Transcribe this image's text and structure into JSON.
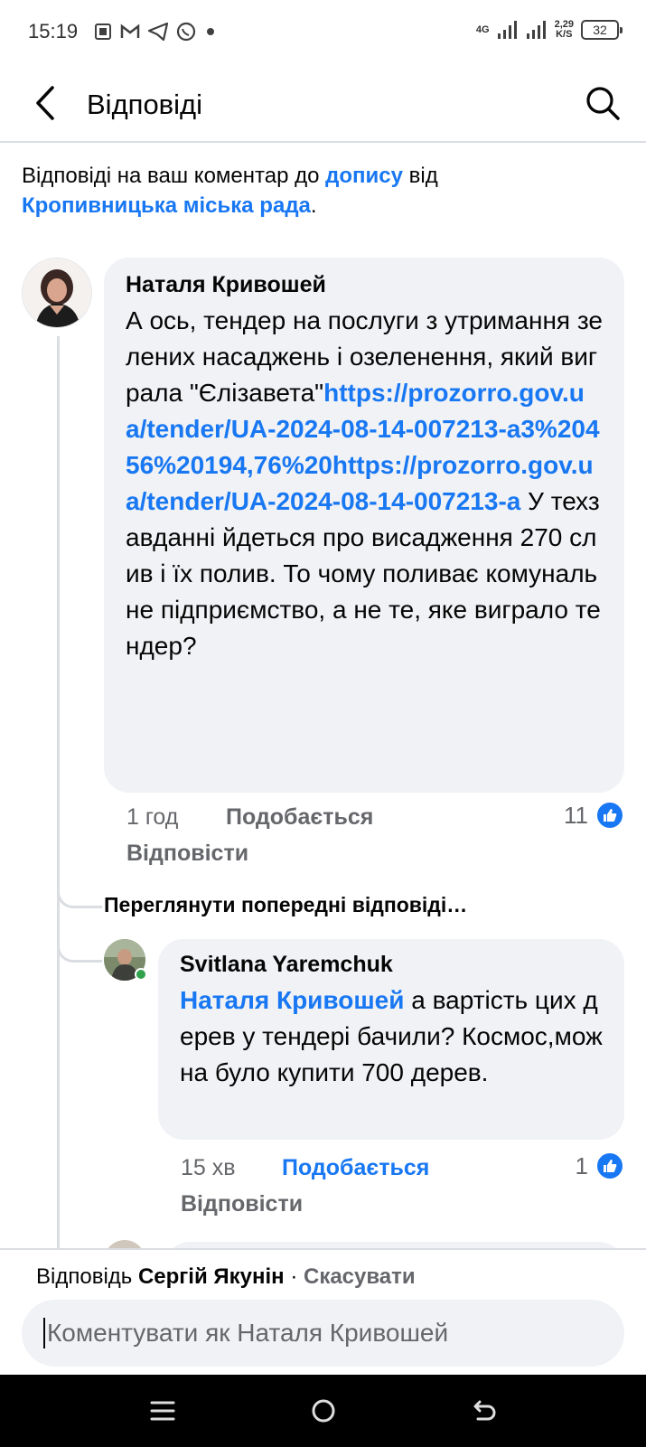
{
  "status_bar": {
    "time": "15:19",
    "network": "4G",
    "speed_value": "2,29",
    "speed_unit": "K/S",
    "battery": "32",
    "icons": [
      "sim-icon",
      "gmail-icon",
      "telegram-icon",
      "whatsapp-icon",
      "dot-icon",
      "signal-icon",
      "signal-icon"
    ]
  },
  "header": {
    "title": "Відповіді",
    "back_icon": "back-arrow-icon",
    "search_icon": "search-icon"
  },
  "intro": {
    "prefix": "Відповіді на ваш коментар до ",
    "post_link": "допису",
    "middle": " від ",
    "page_link": "Кропивницька міська рада",
    "suffix": "."
  },
  "comment_main": {
    "author": "Наталя Кривошей",
    "text_before": "А ось, тендер на послуги з утримання зелених насаджень і озеленення, який виграла \"Єлізавета\"",
    "link": "https://prozorro.gov.ua/tender/UA-2024-08-14-007213-a3%20456%20194,76%20https://prozorro.gov.ua/tender/UA-2024-08-14-007213-a",
    "text_after": " У техзавданні йдеться про висадження 270 слив і їх полив. То чому поливає комунальне підприємство, а не те, яке виграло тендер?",
    "time": "1 год",
    "like_label": "Подобається",
    "reply_label": "Відповісти",
    "like_count": "11"
  },
  "view_previous": "Переглянути попередні відповіді…",
  "comment_reply": {
    "author": "Svitlana Yaremchuk",
    "mention": "Наталя Кривошей",
    "text": " а вартість цих дерев у тендері бачили? Космос,можна було купити 700 дерев.",
    "time": "15 хв",
    "like_label": "Подобається",
    "reply_label": "Відповісти",
    "like_count": "1"
  },
  "reply_bar": {
    "prefix": "Відповідь ",
    "target": "Сергій Якунін",
    "separator": " · ",
    "cancel": "Скасувати",
    "placeholder": "Коментувати як Наталя Кривошей"
  },
  "colors": {
    "accent": "#1877f2",
    "bubble": "#f0f2f5",
    "muted": "#65676b",
    "divider": "#dadde1"
  }
}
